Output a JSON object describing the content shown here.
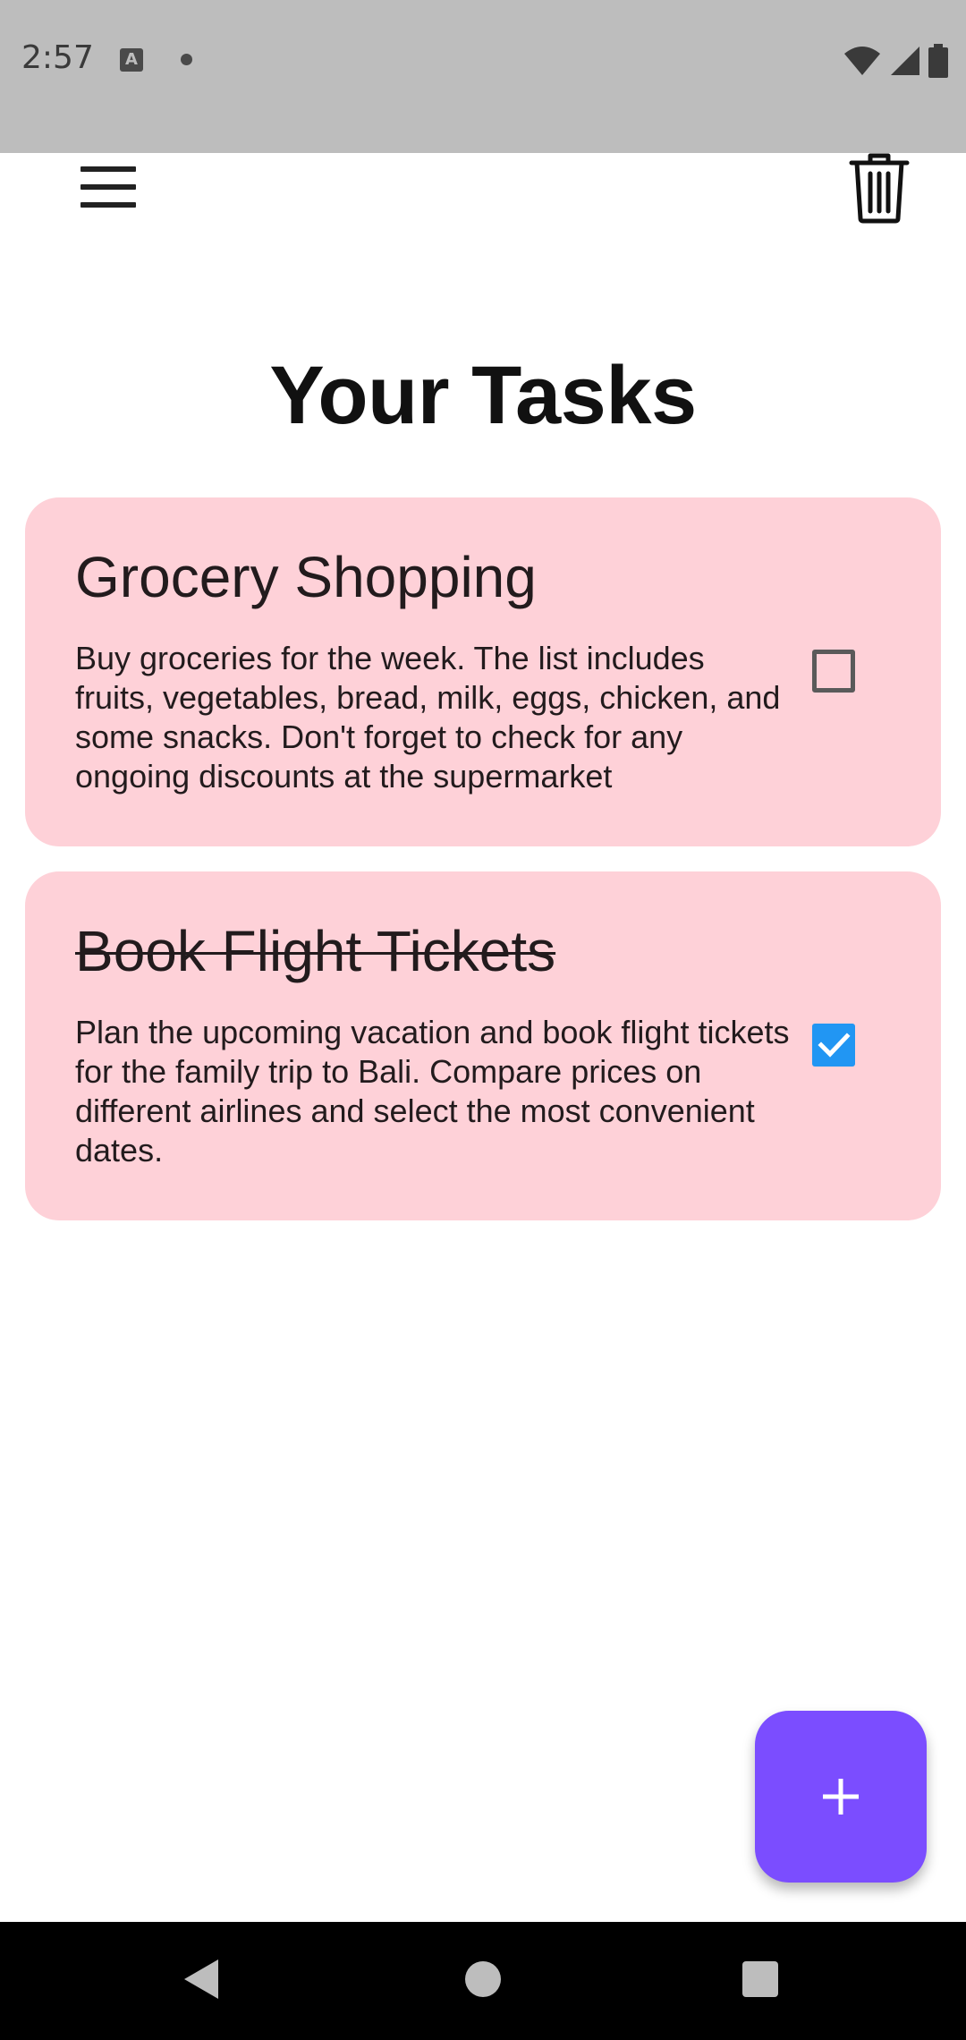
{
  "status_bar": {
    "time": "2:57",
    "icons": [
      "a-notification-icon",
      "dot-icon",
      "wifi-icon",
      "signal-icon",
      "battery-icon"
    ]
  },
  "app_bar": {
    "menu_icon": "menu-icon",
    "delete_icon": "trash-icon"
  },
  "page": {
    "title": "Your Tasks"
  },
  "tasks": [
    {
      "title": "Grocery Shopping",
      "description": "Buy groceries for the week. The list includes fruits, vegetables, bread, milk, eggs, chicken, and some snacks. Don't forget to check for any ongoing discounts at the supermarket",
      "completed": false
    },
    {
      "title": "Book Flight Tickets",
      "description": "Plan the upcoming vacation and book flight tickets for the family trip to Bali. Compare prices on different airlines and select the most convenient dates.",
      "completed": true
    }
  ],
  "fab": {
    "icon": "plus-icon"
  },
  "nav_bar": {
    "icons": [
      "back-icon",
      "home-icon",
      "recents-icon"
    ]
  },
  "colors": {
    "status_bar": "#bdbdbd",
    "card_background": "#fed1d8",
    "fab_background": "#7b4dff",
    "checkbox_checked": "#2196f3",
    "nav_bar": "#000000"
  }
}
